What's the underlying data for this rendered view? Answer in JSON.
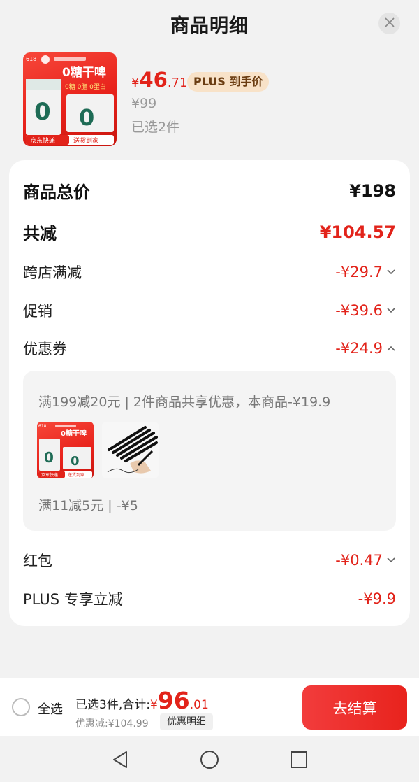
{
  "sheet": {
    "title": "商品明细"
  },
  "product": {
    "price_symbol": "¥",
    "price_int": "46",
    "price_dec": ".71",
    "plus_badge": "PLUS 到手价",
    "original_price": "¥99",
    "selected": "已选2件",
    "thumb_text": {
      "badge_top": "618",
      "title": "0糖干啤",
      "sub": "0糖 0脂 0蛋白",
      "zero": "0",
      "footer_left": "京东快递",
      "footer_right": "送货到家"
    }
  },
  "breakdown": {
    "total": {
      "label": "商品总价",
      "value": "¥198"
    },
    "reduce": {
      "label": "共减",
      "value": "¥104.57"
    },
    "cross_store": {
      "label": "跨店满减",
      "value": "-¥29.7"
    },
    "promo": {
      "label": "促销",
      "value": "-¥39.6"
    },
    "coupon": {
      "label": "优惠券",
      "value": "-¥24.9",
      "detail1": "满199减20元 | 2件商品共享优惠，本商品-¥19.9",
      "detail2": "满11减5元 | -¥5"
    },
    "red_packet": {
      "label": "红包",
      "value": "-¥0.47"
    },
    "plus_off": {
      "label": "PLUS 专享立减",
      "value": "-¥9.9"
    }
  },
  "bottom": {
    "select_all": "全选",
    "total_label": "已选3件,合计:",
    "total_sym": "¥",
    "total_int": "96",
    "total_dec": ".01",
    "discount": "优惠减:¥104.99",
    "detail_link": "优惠明细",
    "checkout": "去结算"
  },
  "icons": {
    "close": "close-icon",
    "chevron_down": "chevron-down-icon",
    "chevron_up": "chevron-up-icon",
    "nav_back": "back-triangle-icon",
    "nav_home": "home-circle-icon",
    "nav_recent": "recent-square-icon"
  },
  "colors": {
    "accent": "#e2231a",
    "plus_badge_bg": "#f8e2c8",
    "plus_badge_text": "#6b3d12"
  }
}
